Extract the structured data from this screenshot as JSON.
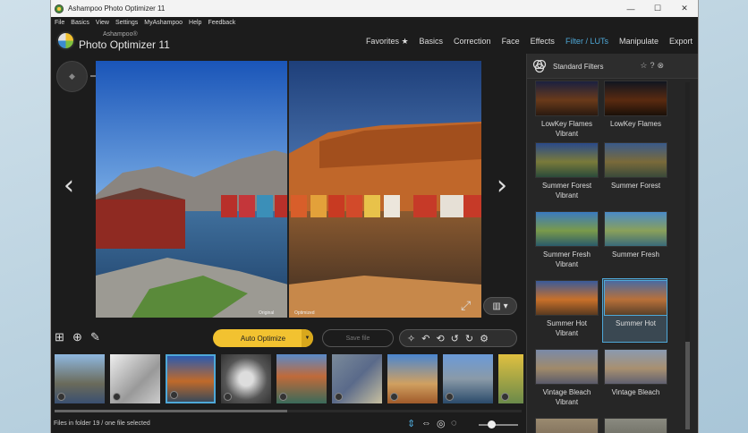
{
  "window": {
    "title": "Ashampoo Photo Optimizer 11",
    "controls": {
      "minimize": "—",
      "maximize": "☐",
      "close": "✕"
    }
  },
  "menu": [
    "File",
    "Basics",
    "View",
    "Settings",
    "MyAshampoo",
    "Help",
    "Feedback"
  ],
  "brand": {
    "small": "Ashampoo®",
    "name": "Photo Optimizer 11"
  },
  "nav_tabs": [
    "Favorites ★",
    "Basics",
    "Correction",
    "Face",
    "Effects",
    "Filter / LUTs",
    "Manipulate",
    "Export"
  ],
  "active_tab": "Filter / LUTs",
  "viewer": {
    "label_original": "Original",
    "label_optimized": "Optimized",
    "zoom_level": 0.37
  },
  "toolbar": {
    "auto_optimize": "Auto Optimize",
    "save_file": "Save file"
  },
  "status": {
    "text": "Files in folder 19 / one file selected",
    "zoom_level": 0.32
  },
  "panel": {
    "title": "Standard Filters",
    "filters": [
      {
        "name": "LowKey Flames Vibrant",
        "selected": false
      },
      {
        "name": "LowKey Flames",
        "selected": false
      },
      {
        "name": "Summer Forest Vibrant",
        "selected": false
      },
      {
        "name": "Summer Forest",
        "selected": false
      },
      {
        "name": "Summer Fresh Vibrant",
        "selected": false
      },
      {
        "name": "Summer Fresh",
        "selected": false
      },
      {
        "name": "Summer Hot Vibrant",
        "selected": false
      },
      {
        "name": "Summer Hot",
        "selected": true
      },
      {
        "name": "Vintage Bleach Vibrant",
        "selected": false
      },
      {
        "name": "Vintage Bleach",
        "selected": false
      }
    ]
  },
  "colors": {
    "accent_blue": "#4ea8d8",
    "button_yellow": "#f2c230",
    "background": "#1c1c1c"
  }
}
